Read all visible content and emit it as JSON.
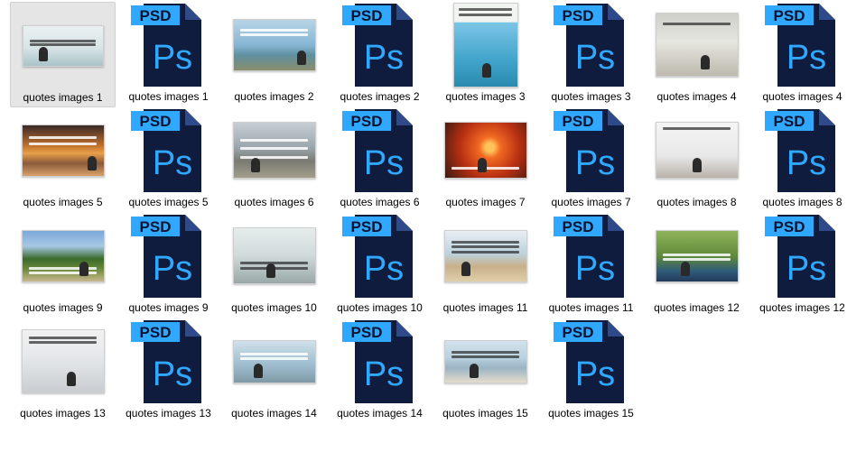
{
  "icons": {
    "psd_badge_text": "PSD",
    "psd_logo_text": "Ps",
    "psd_body_color": "#101c3e",
    "psd_badge_color": "#31a8ff"
  },
  "items": [
    {
      "label": "quotes images 1",
      "type": "image",
      "selected": true,
      "theme": "mist"
    },
    {
      "label": "quotes images 1",
      "type": "psd"
    },
    {
      "label": "quotes images 2",
      "type": "image",
      "theme": "coast"
    },
    {
      "label": "quotes images 2",
      "type": "psd"
    },
    {
      "label": "quotes images 3",
      "type": "image",
      "theme": "pool"
    },
    {
      "label": "quotes images 3",
      "type": "psd"
    },
    {
      "label": "quotes images 4",
      "type": "image",
      "theme": "studio"
    },
    {
      "label": "quotes images 4",
      "type": "psd"
    },
    {
      "label": "quotes images 5",
      "type": "image",
      "theme": "sunset-lake"
    },
    {
      "label": "quotes images 5",
      "type": "psd"
    },
    {
      "label": "quotes images 6",
      "type": "image",
      "theme": "mountain"
    },
    {
      "label": "quotes images 6",
      "type": "psd"
    },
    {
      "label": "quotes images 7",
      "type": "image",
      "theme": "red-sunset"
    },
    {
      "label": "quotes images 7",
      "type": "psd"
    },
    {
      "label": "quotes images 8",
      "type": "image",
      "theme": "gym"
    },
    {
      "label": "quotes images 8",
      "type": "psd"
    },
    {
      "label": "quotes images 9",
      "type": "image",
      "theme": "palms"
    },
    {
      "label": "quotes images 9",
      "type": "psd"
    },
    {
      "label": "quotes images 10",
      "type": "image",
      "theme": "hands"
    },
    {
      "label": "quotes images 10",
      "type": "psd"
    },
    {
      "label": "quotes images 11",
      "type": "image",
      "theme": "beach-duo"
    },
    {
      "label": "quotes images 11",
      "type": "psd"
    },
    {
      "label": "quotes images 12",
      "type": "image",
      "theme": "park"
    },
    {
      "label": "quotes images 12",
      "type": "psd"
    },
    {
      "label": "quotes images 13",
      "type": "image",
      "theme": "couple"
    },
    {
      "label": "quotes images 13",
      "type": "psd"
    },
    {
      "label": "quotes images 14",
      "type": "image",
      "theme": "sea-meditate"
    },
    {
      "label": "quotes images 14",
      "type": "psd"
    },
    {
      "label": "quotes images 15",
      "type": "image",
      "theme": "shore-lunge"
    },
    {
      "label": "quotes images 15",
      "type": "psd"
    }
  ]
}
